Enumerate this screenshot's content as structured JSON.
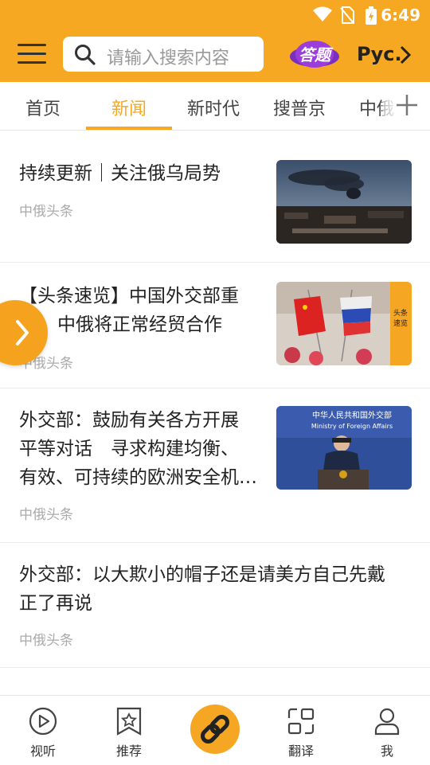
{
  "status_bar": {
    "time": "6:49"
  },
  "header": {
    "search_placeholder": "请输入搜索内容",
    "badge_text": "答题",
    "language": "Рус."
  },
  "tabs": [
    {
      "label": "首页"
    },
    {
      "label": "新闻",
      "active": true
    },
    {
      "label": "新时代"
    },
    {
      "label": "搜普京"
    },
    {
      "label": "中俄"
    }
  ],
  "feed": [
    {
      "title_lines": [
        "持续更新｜关注俄乌局势"
      ],
      "source": "中俄头条",
      "thumb": "smoke-city-photo"
    },
    {
      "title_lines": [
        "【头条速览】中国外交部重",
        "中俄将正常经贸合作"
      ],
      "source": "中俄头条",
      "thumb": "china-russia-flags-photo",
      "thumb_label": "头条速览"
    },
    {
      "title_lines": [
        "外交部：鼓励有关各方开展",
        "平等对话　寻求构建均衡、",
        "有效、可持续的欧洲安全机…"
      ],
      "source": "中俄头条",
      "thumb": "press-conference-photo",
      "thumb_label_cn": "中华人民共和国外交部",
      "thumb_label_en": "Ministry of Foreign Affairs"
    },
    {
      "title_lines": [
        "外交部：以大欺小的帽子还是请美方自己先戴",
        "正了再说"
      ],
      "source": "中俄头条"
    }
  ],
  "bottom_nav": [
    {
      "label": "视听",
      "icon": "play-icon"
    },
    {
      "label": "推荐",
      "icon": "star-bookmark-icon"
    },
    {
      "label": "",
      "icon": "link-icon"
    },
    {
      "label": "翻译",
      "icon": "translate-icon"
    },
    {
      "label": "我",
      "icon": "user-icon"
    }
  ],
  "colors": {
    "accent": "#F7A823",
    "text": "#222222",
    "muted": "#aaaaaa"
  }
}
